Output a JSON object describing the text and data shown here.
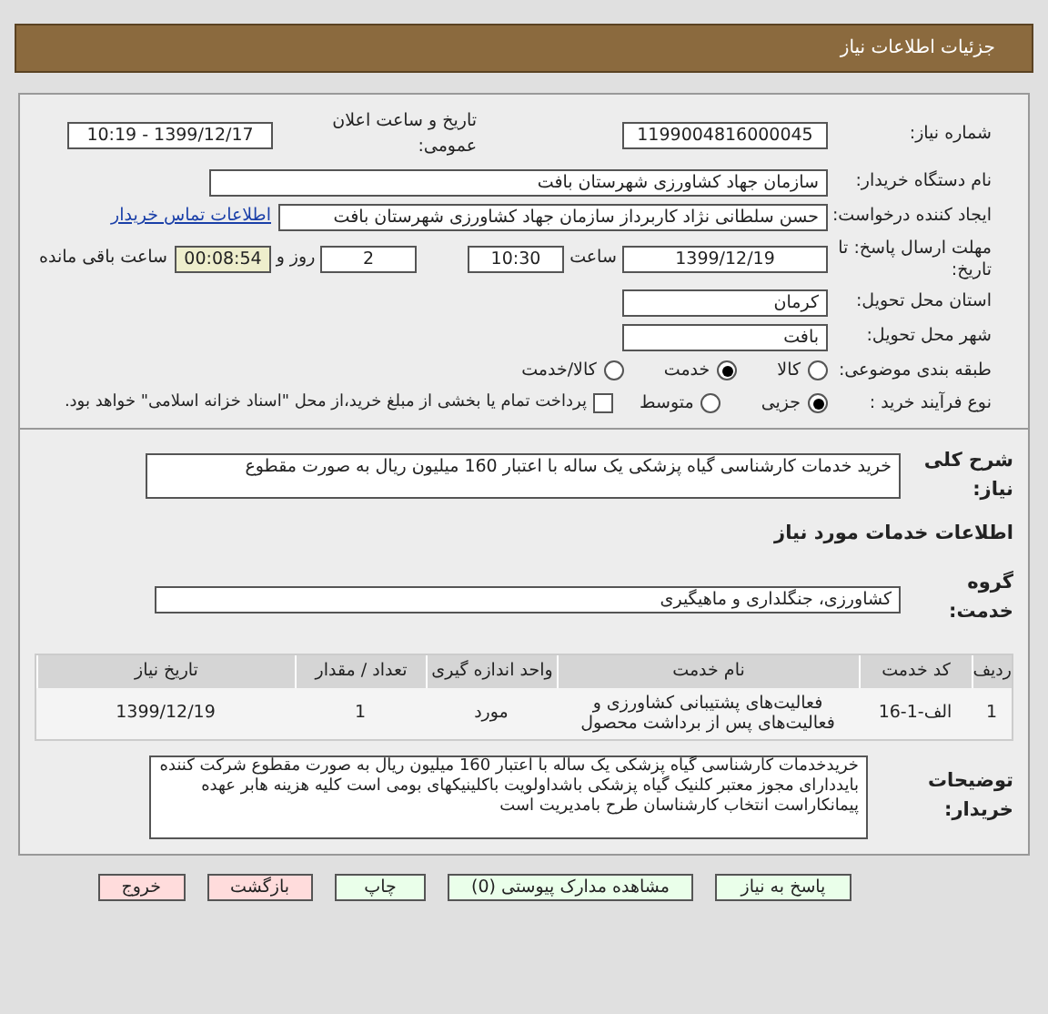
{
  "header": {
    "title": "جزئیات اطلاعات نیاز"
  },
  "need_number": {
    "label": "شماره نیاز:",
    "value": "1199004816000045"
  },
  "announce": {
    "label": "تاریخ و ساعت اعلان عمومی:",
    "value": "1399/12/17 - 10:19"
  },
  "buyer_org": {
    "label": "نام دستگاه خریدار:",
    "value": "سازمان جهاد کشاورزی شهرستان بافت"
  },
  "creator": {
    "label": "ایجاد کننده درخواست:",
    "value": "حسن سلطانی نژاد کاربرداز سازمان جهاد کشاورزی شهرستان بافت",
    "link": "اطلاعات تماس خریدار"
  },
  "deadline": {
    "label": "مهلت ارسال پاسخ: تا تاریخ:",
    "date": "1399/12/19",
    "time_label": "ساعت",
    "time": "10:30",
    "days": "2",
    "days_label": "روز و",
    "remaining": "00:08:54",
    "remaining_label": "ساعت باقی مانده"
  },
  "province": {
    "label": "استان محل تحویل:",
    "value": "کرمان"
  },
  "city": {
    "label": "شهر محل تحویل:",
    "value": "بافت"
  },
  "category": {
    "label": "طبقه بندی موضوعی:",
    "options": [
      {
        "label": "کالا",
        "selected": false
      },
      {
        "label": "خدمت",
        "selected": true
      },
      {
        "label": "کالا/خدمت",
        "selected": false
      }
    ]
  },
  "purchase_type": {
    "label": "نوع فرآیند خرید :",
    "options": [
      {
        "label": "جزیی",
        "selected": true
      },
      {
        "label": "متوسط",
        "selected": false
      }
    ],
    "payment": {
      "checked": false,
      "label": "پرداخت تمام یا بخشی از مبلغ خرید،از محل \"اسناد خزانه اسلامی\" خواهد بود."
    }
  },
  "description": {
    "label": "شرح کلی نیاز:",
    "value": "خرید خدمات کارشناسی گیاه پزشکی یک ساله با اعتبار 160 میلیون ریال به صورت مقطوع"
  },
  "services_title": "اطلاعات خدمات مورد نیاز",
  "service_group": {
    "label": "گروه خدمت:",
    "value": "کشاورزی، جنگلداری و ماهیگیری"
  },
  "table": {
    "columns": [
      "ردیف",
      "کد خدمت",
      "نام خدمت",
      "واحد اندازه گیری",
      "تعداد / مقدار",
      "تاریخ نیاز"
    ],
    "rows": [
      [
        "1",
        "الف-1-16",
        "فعالیت‌های پشتیبانی کشاورزی و فعالیت‌های پس از برداشت محصول",
        "مورد",
        "1",
        "1399/12/19"
      ]
    ]
  },
  "buyer_notes": {
    "label": "توضیحات خریدار:",
    "value": "خریدخدمات کارشناسی گیاه پزشکی یک ساله با اعتبار 160 میلیون ریال به صورت مقطوع شرکت کننده بایددارای مجوز معتبر کلنیک گیاه پزشکی باشداولویت باکلینیکهای بومی است کلیه هزینه هابر عهده پیمانکاراست انتخاب کارشناسان طرح بامدیریت است"
  },
  "buttons": [
    {
      "label": "پاسخ به نیاز",
      "kind": "primary"
    },
    {
      "label": "مشاهده مدارک پیوستی (0)",
      "kind": "primary"
    },
    {
      "label": "چاپ",
      "kind": "primary"
    },
    {
      "label": "بازگشت",
      "kind": "danger"
    },
    {
      "label": "خروج",
      "kind": "danger"
    }
  ]
}
